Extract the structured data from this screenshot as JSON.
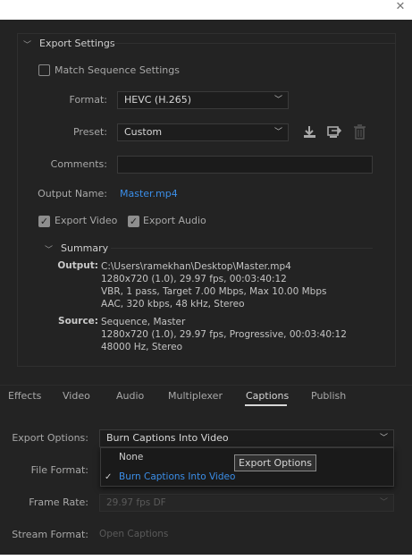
{
  "window": {
    "close_icon": "close-icon"
  },
  "export_settings": {
    "section_title": "Export Settings",
    "match_sequence": {
      "label": "Match Sequence Settings",
      "checked": false
    },
    "format": {
      "label": "Format:",
      "value": "HEVC (H.265)"
    },
    "preset": {
      "label": "Preset:",
      "value": "Custom",
      "icons": [
        "save-preset-icon",
        "import-preset-icon",
        "delete-preset-icon"
      ]
    },
    "comments": {
      "label": "Comments:",
      "value": ""
    },
    "output_name": {
      "label": "Output Name:",
      "value": "Master.mp4"
    },
    "export_video": {
      "label": "Export Video",
      "checked": true
    },
    "export_audio": {
      "label": "Export Audio",
      "checked": true
    },
    "summary": {
      "title": "Summary",
      "output_label": "Output:",
      "output_lines": [
        "C:\\Users\\ramekhan\\Desktop\\Master.mp4",
        "1280x720 (1.0), 29.97 fps, 00:03:40:12",
        "VBR, 1 pass, Target 7.00 Mbps, Max 10.00 Mbps",
        "AAC, 320 kbps, 48 kHz, Stereo"
      ],
      "source_label": "Source:",
      "source_lines": [
        "Sequence, Master",
        "1280x720 (1.0), 29.97 fps, Progressive, 00:03:40:12",
        "48000 Hz, Stereo"
      ]
    }
  },
  "tabs": [
    {
      "label": "Effects",
      "active": false
    },
    {
      "label": "Video",
      "active": false
    },
    {
      "label": "Audio",
      "active": false
    },
    {
      "label": "Multiplexer",
      "active": false
    },
    {
      "label": "Captions",
      "active": true
    },
    {
      "label": "Publish",
      "active": false
    }
  ],
  "captions": {
    "export_options": {
      "label": "Export Options:",
      "value": "Burn Captions Into Video"
    },
    "file_format": {
      "label": "File Format:"
    },
    "frame_rate": {
      "label": "Frame Rate:",
      "value": "29.97 fps DF"
    },
    "stream_format": {
      "label": "Stream Format:",
      "value": "Open Captions"
    },
    "menu_options": [
      {
        "label": "None",
        "selected": false
      },
      {
        "label": "Burn Captions Into Video",
        "selected": true
      }
    ],
    "tooltip": "Export Options"
  },
  "colors": {
    "accent": "#3b8ee8",
    "background": "#232323"
  }
}
